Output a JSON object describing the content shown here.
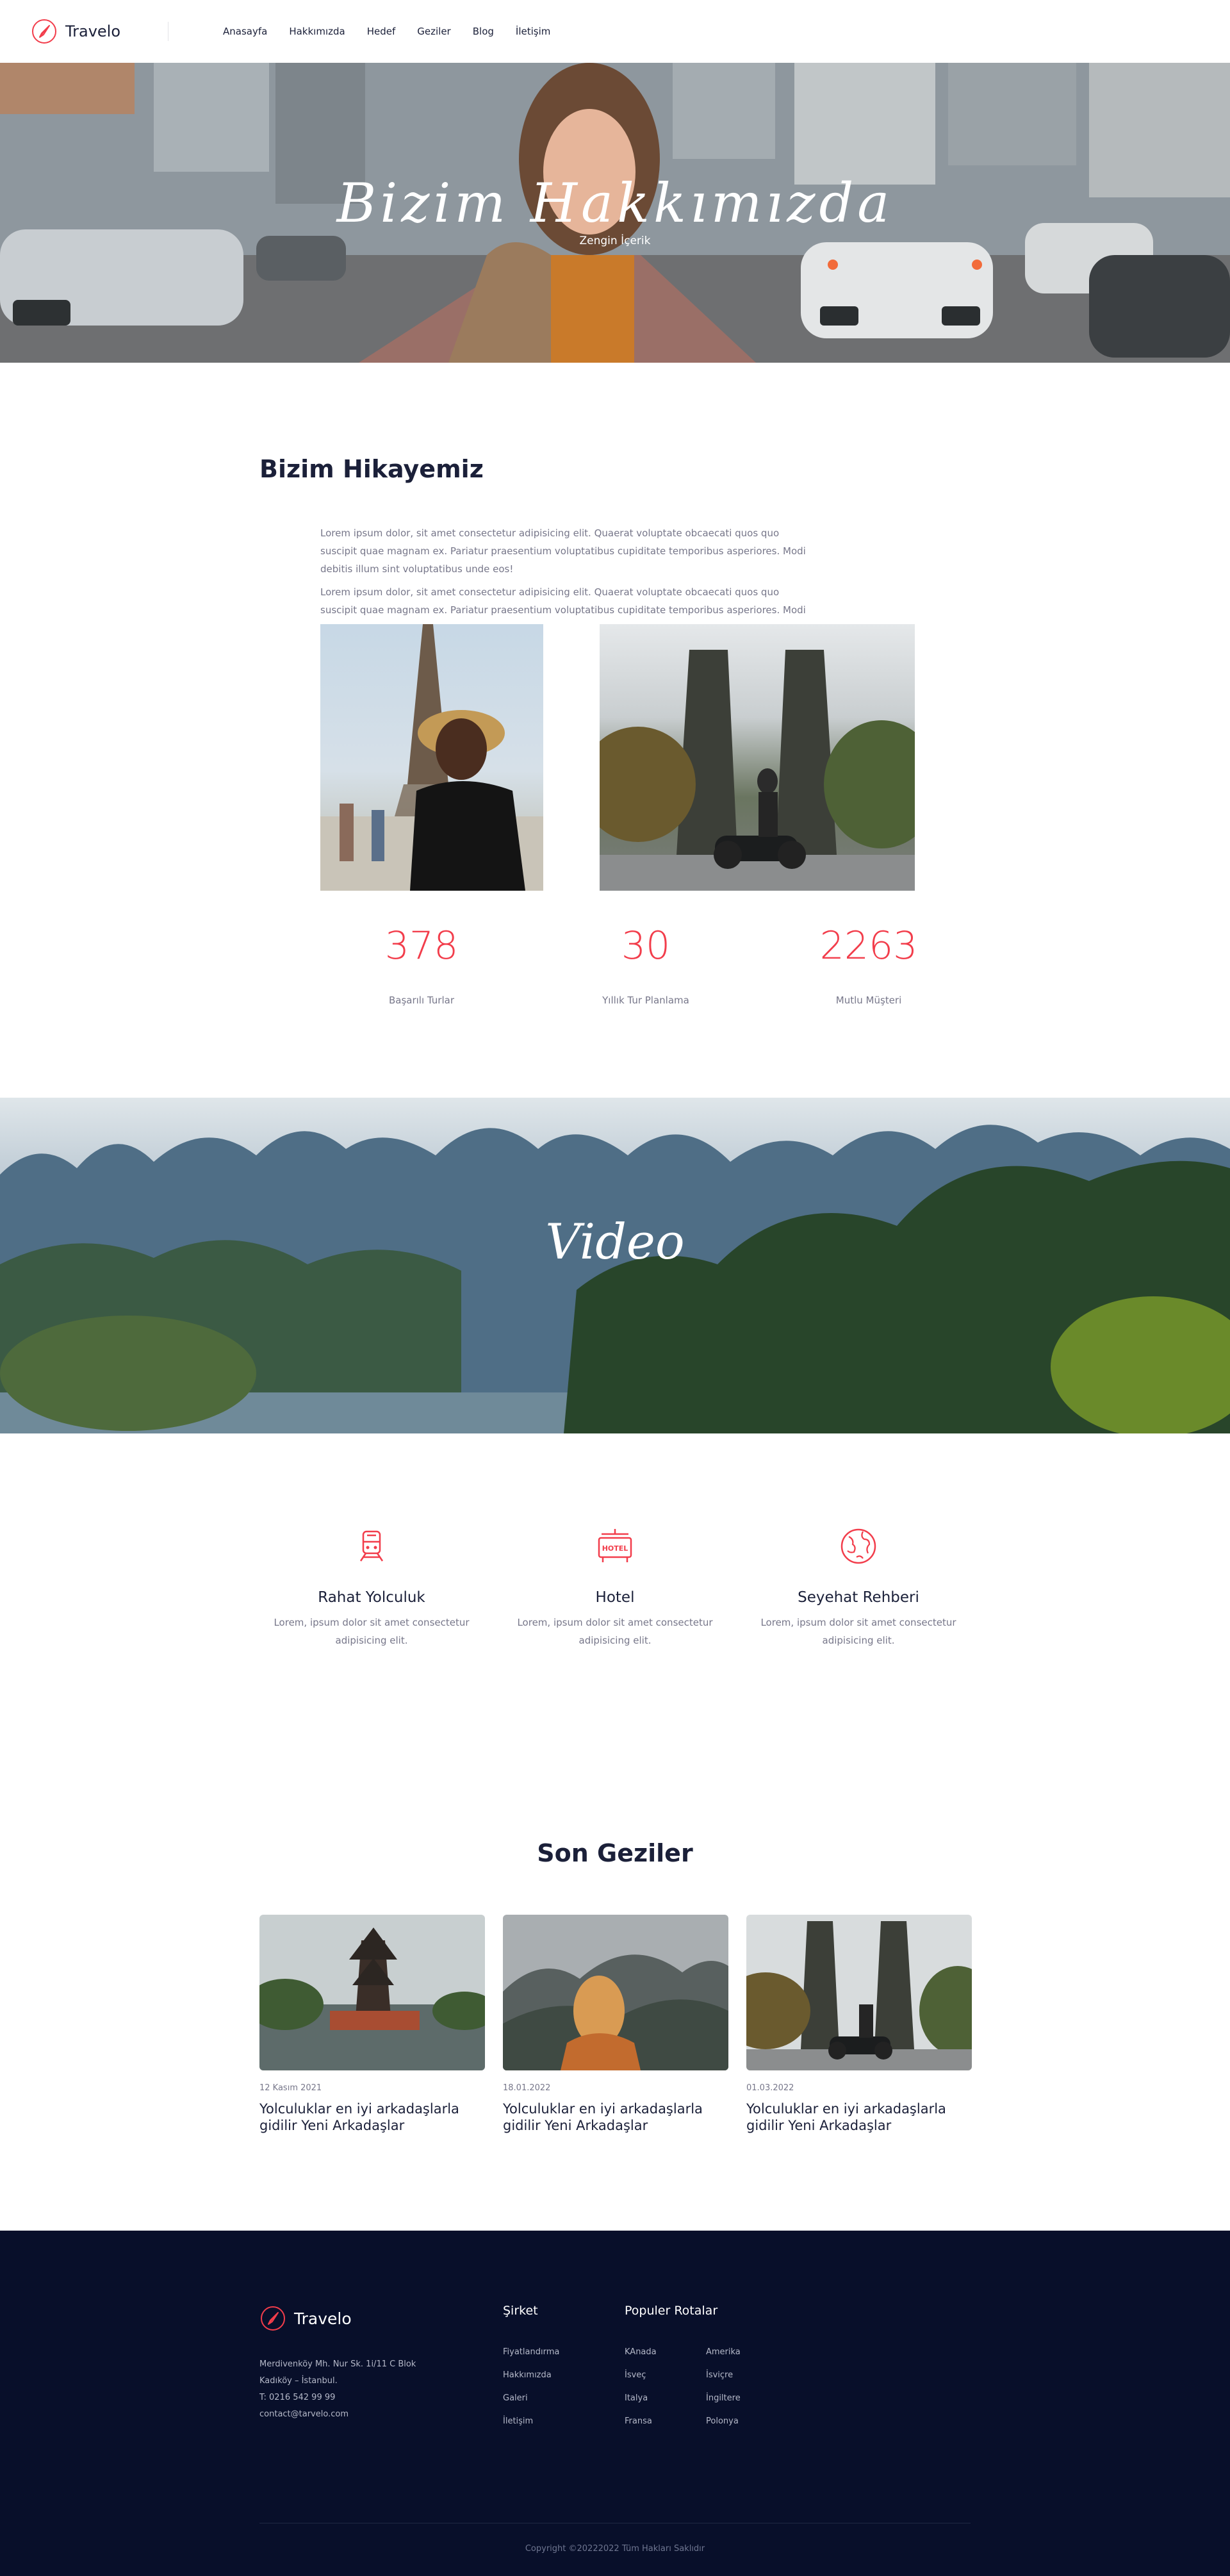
{
  "brand": {
    "name": "Travelo",
    "accent": "#f23d4b"
  },
  "nav": {
    "items": [
      "Anasayfa",
      "Hakkımızda",
      "Hedef",
      "Geziler",
      "Blog",
      "İletişim"
    ]
  },
  "hero": {
    "title": "Bizim Hakkımızda",
    "subtitle": "Zengin İçerik"
  },
  "story": {
    "title": "Bizim Hikayemiz",
    "paragraphs": [
      "Lorem ipsum dolor, sit amet consectetur adipisicing elit. Quaerat voluptate obcaecati quos quo suscipit quae magnam ex. Pariatur praesentium voluptatibus cupiditate temporibus asperiores. Modi debitis illum sint voluptatibus unde eos!",
      "Lorem ipsum dolor, sit amet consectetur adipisicing elit. Quaerat voluptate obcaecati quos quo suscipit quae magnam ex. Pariatur praesentium voluptatibus cupiditate temporibus asperiores. Modi"
    ]
  },
  "stats": [
    {
      "value": "378",
      "label": "Başarılı Turlar"
    },
    {
      "value": "30",
      "label": "Yıllık Tur Planlama"
    },
    {
      "value": "2263",
      "label": "Mutlu Müşteri"
    }
  ],
  "video": {
    "title": "Video"
  },
  "features": [
    {
      "icon": "train-icon",
      "title": "Rahat Yolculuk",
      "desc": "Lorem, ipsum dolor sit amet consectetur adipisicing elit."
    },
    {
      "icon": "hotel-icon",
      "icon_text": "HOTEL",
      "title": "Hotel",
      "desc": "Lorem, ipsum dolor sit amet consectetur adipisicing elit."
    },
    {
      "icon": "globe-icon",
      "title": "Seyehat Rehberi",
      "desc": "Lorem, ipsum dolor sit amet consectetur adipisicing elit."
    }
  ],
  "trips": {
    "title": "Son Geziler",
    "items": [
      {
        "date": "12 Kasım 2021",
        "title": "Yolculuklar en iyi arkadaşlarla gidilir Yeni Arkadaşlar"
      },
      {
        "date": "18.01.2022",
        "title": "Yolculuklar en iyi arkadaşlarla gidilir Yeni Arkadaşlar"
      },
      {
        "date": "01.03.2022",
        "title": "Yolculuklar en iyi arkadaşlarla gidilir Yeni Arkadaşlar"
      }
    ]
  },
  "footer": {
    "brand": "Travelo",
    "address": [
      "Merdivenköy Mh. Nur Sk. 1i/11 C Blok",
      "Kadıköy – İstanbul.",
      "T: 0216 542 99 99",
      "contact@tarvelo.com"
    ],
    "company_title": "Şirket",
    "company_links": [
      "Fiyatlandırma",
      "Hakkımızda",
      "Galeri",
      "İletişim"
    ],
    "routes_title": "Populer Rotalar",
    "routes_col1": [
      "KAnada",
      "İsveç",
      "Italya",
      "Fransa"
    ],
    "routes_col2": [
      "Amerika",
      "İsviçre",
      "İngiltere",
      "Polonya"
    ],
    "copyright": "Copyright ©20222022 Tüm Hakları Saklıdır"
  },
  "colors": {
    "accent": "#f23d4b",
    "footer_bg": "#080f2a",
    "text_dark": "#1b2039",
    "text_muted": "#77778a"
  }
}
